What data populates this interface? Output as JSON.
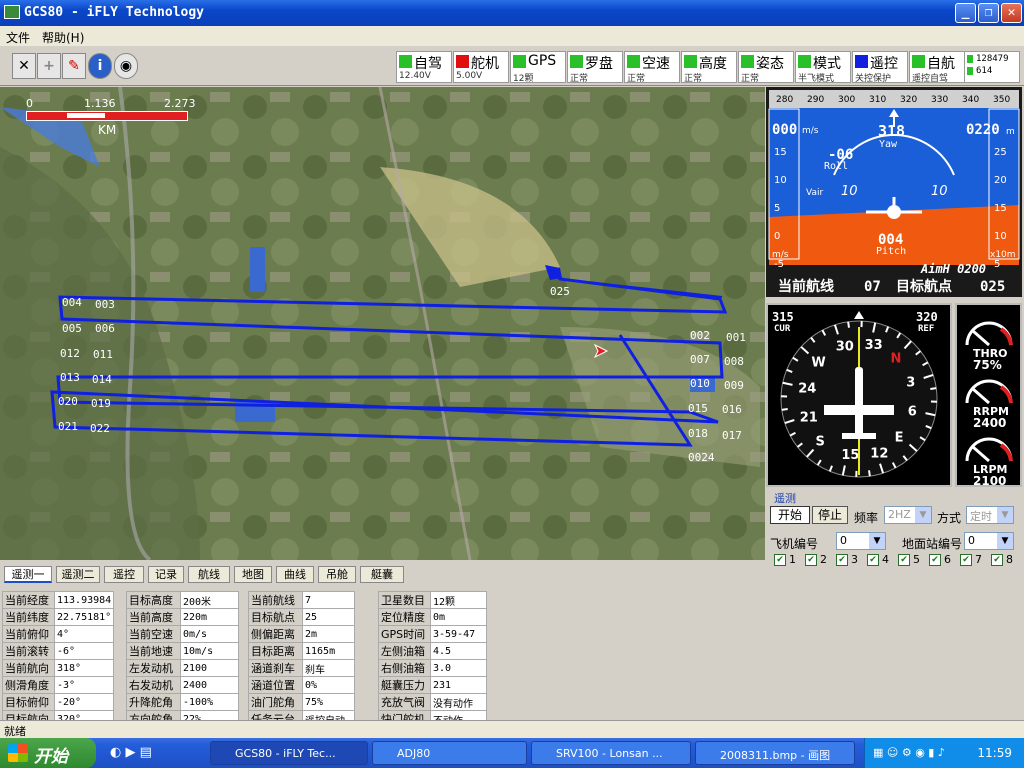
{
  "window": {
    "title": "GCS80 - iFLY Technology"
  },
  "menu": {
    "file": "文件",
    "help": "帮助(H)"
  },
  "status_indicators": [
    {
      "label": "自驾",
      "sub": "12.40V",
      "color": "#2ac02a"
    },
    {
      "label": "舵机",
      "sub": "5.00V",
      "color": "#e01010"
    },
    {
      "label": "GPS",
      "sub": "12颗",
      "color": "#2ac02a"
    },
    {
      "label": "罗盘",
      "sub": "正常",
      "color": "#2ac02a"
    },
    {
      "label": "空速",
      "sub": "正常",
      "color": "#2ac02a"
    },
    {
      "label": "高度",
      "sub": "正常",
      "color": "#2ac02a"
    },
    {
      "label": "姿态",
      "sub": "正常",
      "color": "#2ac02a"
    },
    {
      "label": "模式",
      "sub": "半飞模式",
      "color": "#2ac02a"
    },
    {
      "label": "遥控",
      "sub": "关控保护",
      "color": "#1020e0"
    },
    {
      "label": "自航",
      "sub": "遥控自驾",
      "color": "#2ac02a"
    }
  ],
  "counters": [
    "128479",
    "614"
  ],
  "scale": {
    "v0": "0",
    "v1": "1.136",
    "v2": "2.273",
    "unit": "KM"
  },
  "waypoints": [
    "001",
    "002",
    "003",
    "004",
    "005",
    "006",
    "007",
    "008",
    "009",
    "010",
    "011",
    "012",
    "013",
    "014",
    "015",
    "016",
    "017",
    "018",
    "019",
    "020",
    "021",
    "022",
    "0024",
    "025"
  ],
  "pfd": {
    "heading_scale": [
      "280",
      "290",
      "300",
      "310",
      "320",
      "330",
      "340",
      "350"
    ],
    "speed": "000",
    "speed_unit": "m/s",
    "alt": "0220",
    "alt_unit": "m",
    "yaw": "318",
    "yaw_label": "Yaw",
    "roll": "-06",
    "roll_label": "Roll",
    "pitch": "004",
    "pitch_label": "Pitch",
    "vair": "Vair",
    "left_scale": [
      "15",
      "10",
      "5",
      "0",
      "-5"
    ],
    "right_scale": [
      "25",
      "20",
      "15",
      "10",
      "5"
    ],
    "pitch_marks": [
      "10",
      "10"
    ],
    "ms": "m/s",
    "x10m": "x10m",
    "aimh": "AimH 0200",
    "cur_route_label": "当前航线",
    "cur_route": "07",
    "target_wp_label": "目标航点",
    "target_wp": "025"
  },
  "hsi": {
    "cur": "315",
    "cur_label": "CUR",
    "ref": "320",
    "ref_label": "REF",
    "marks": [
      "N",
      "3",
      "6",
      "E",
      "12",
      "15",
      "S",
      "21",
      "24",
      "W",
      "30",
      "33"
    ]
  },
  "gauges": [
    {
      "label": "THRO",
      "value": "75%"
    },
    {
      "label": "RRPM",
      "value": "2400"
    },
    {
      "label": "LRPM",
      "value": "2100"
    }
  ],
  "telemetry": {
    "group": "遥测",
    "start": "开始",
    "stop": "停止",
    "freq_label": "频率",
    "freq": "2HZ",
    "mode_label": "方式",
    "mode": "定时",
    "plane_id_label": "飞机编号",
    "plane_id": "0",
    "station_id_label": "地面站编号",
    "station_id": "0",
    "channels": [
      "1",
      "2",
      "3",
      "4",
      "5",
      "6",
      "7",
      "8"
    ]
  },
  "tabs": [
    "遥测一",
    "遥测二",
    "遥控",
    "记录",
    "航线",
    "地图",
    "曲线",
    "吊舱",
    "艇囊"
  ],
  "data_table": [
    [
      [
        "当前经度",
        "113.93984"
      ],
      [
        "当前纬度",
        "22.75181°"
      ],
      [
        "当前俯仰",
        "4°"
      ],
      [
        "当前滚转",
        "-6°"
      ],
      [
        "当前航向",
        "318°"
      ],
      [
        "侧滑角度",
        "-3°"
      ],
      [
        "目标俯仰",
        "-20°"
      ],
      [
        "目标航向",
        "320°"
      ]
    ],
    [
      [
        "目标高度",
        "200米"
      ],
      [
        "当前高度",
        "220m"
      ],
      [
        "当前空速",
        "0m/s"
      ],
      [
        "当前地速",
        "10m/s"
      ],
      [
        "左发动机",
        "2100"
      ],
      [
        "右发动机",
        "2400"
      ],
      [
        "升降舵角",
        "-100%"
      ],
      [
        "方向舵角",
        "22%"
      ]
    ],
    [
      [
        "当前航线",
        "7"
      ],
      [
        "目标航点",
        "25"
      ],
      [
        "侧偏距离",
        "2m"
      ],
      [
        "目标距离",
        "1165m"
      ],
      [
        "涵道刹车",
        "刹车"
      ],
      [
        "涵道位置",
        "0%"
      ],
      [
        "油门舵角",
        "75%"
      ],
      [
        "任务云台",
        "遥控自动"
      ]
    ],
    [
      [
        "卫星数目",
        "12颗"
      ],
      [
        "定位精度",
        "0m"
      ],
      [
        "GPS时间",
        "3-59-47"
      ],
      [
        "左侧油箱",
        "4.5"
      ],
      [
        "右侧油箱",
        "3.0"
      ],
      [
        "艇囊压力",
        "231"
      ],
      [
        "充放气阀",
        "没有动作"
      ],
      [
        "快门舵机",
        "不动作"
      ]
    ]
  ],
  "statusbar": "就绪",
  "taskbar": {
    "start": "开始",
    "items": [
      "GCS80 - iFLY Tec...",
      "ADJ80",
      "SRV100 - Lonsan ...",
      "2008311.bmp - 画图"
    ],
    "clock": "11:59"
  }
}
